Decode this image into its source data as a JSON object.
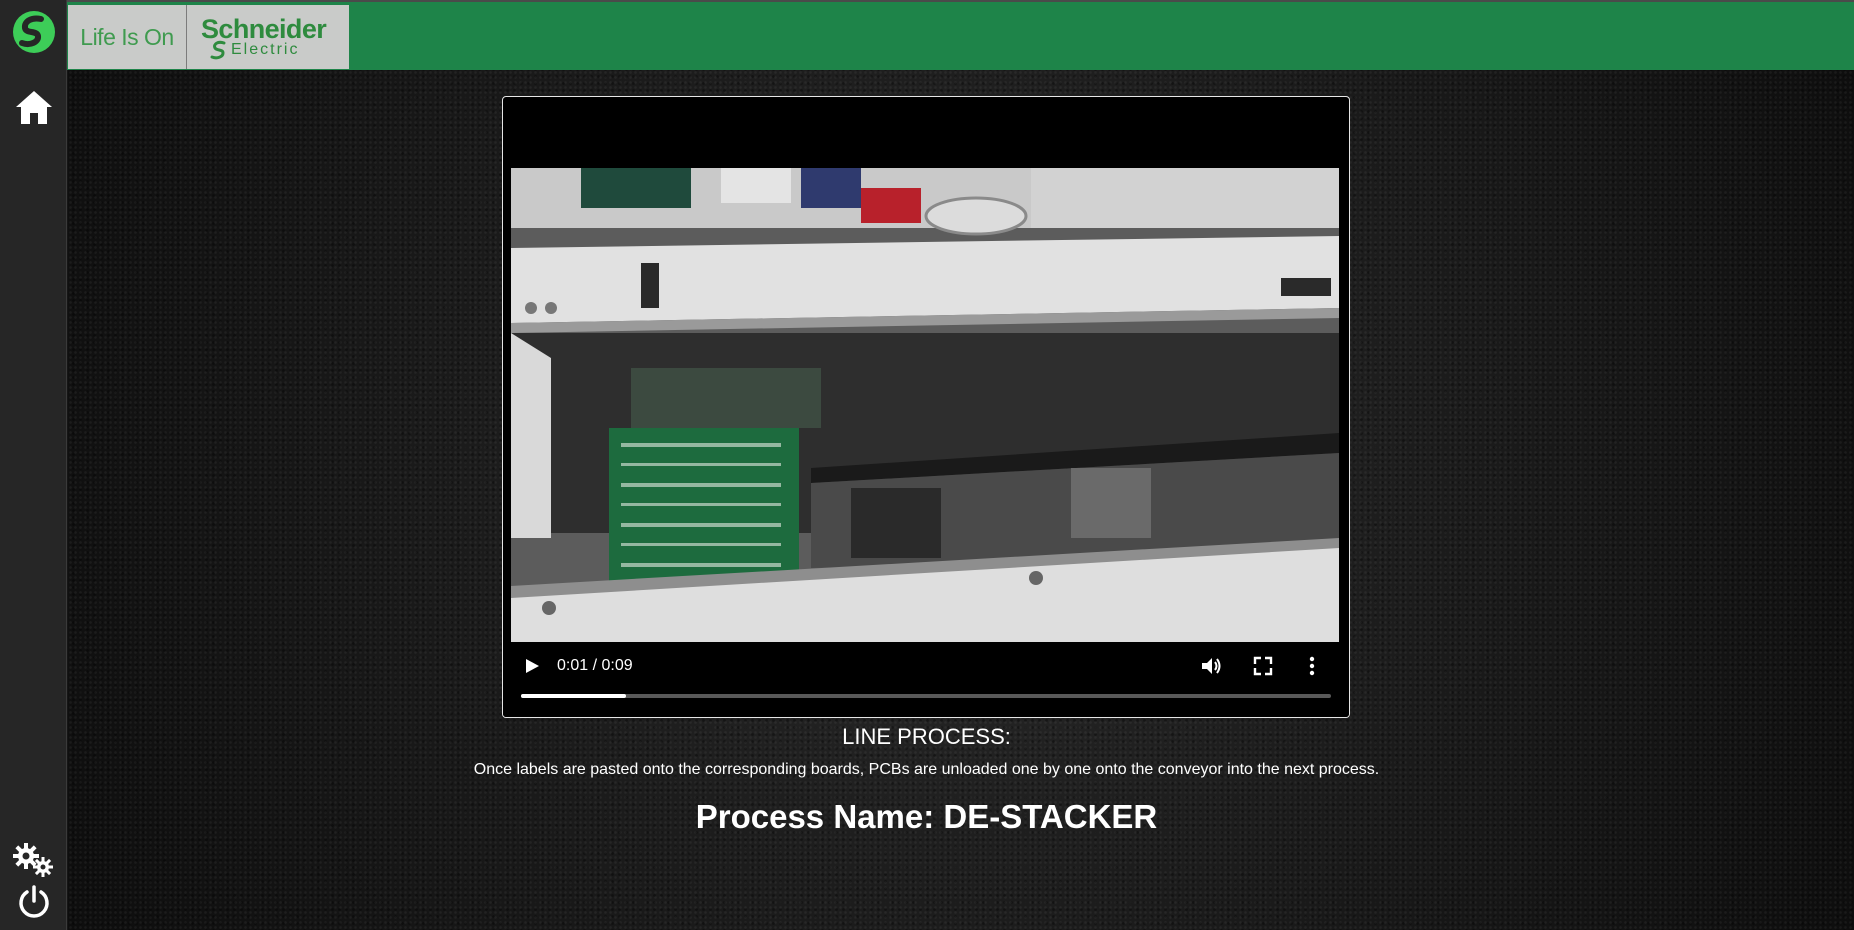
{
  "colors": {
    "topbar": "#1e8449",
    "sidebar": "#262626",
    "brand_green": "#3dcd58",
    "logo_panel": "#c9cbc9"
  },
  "sidebar": {
    "icons": [
      "schneider-mark-icon",
      "home-icon",
      "settings-icon",
      "power-icon"
    ]
  },
  "topbar": {
    "logo_tagline": "Life Is On",
    "logo_company_top": "Schneider",
    "logo_company_bottom": "Electric"
  },
  "video": {
    "time": "0:01 / 0:09",
    "progress_fraction": 0.13,
    "controls": [
      "play-icon",
      "volume-icon",
      "fullscreen-icon",
      "more-options-icon"
    ]
  },
  "content": {
    "line_process_title": "LINE PROCESS:",
    "line_process_description": "Once labels are pasted onto the corresponding boards, PCBs are unloaded one by one onto the conveyor into the next process.",
    "process_name_label": "Process Name:",
    "process_name_value": "DE-STACKER"
  }
}
